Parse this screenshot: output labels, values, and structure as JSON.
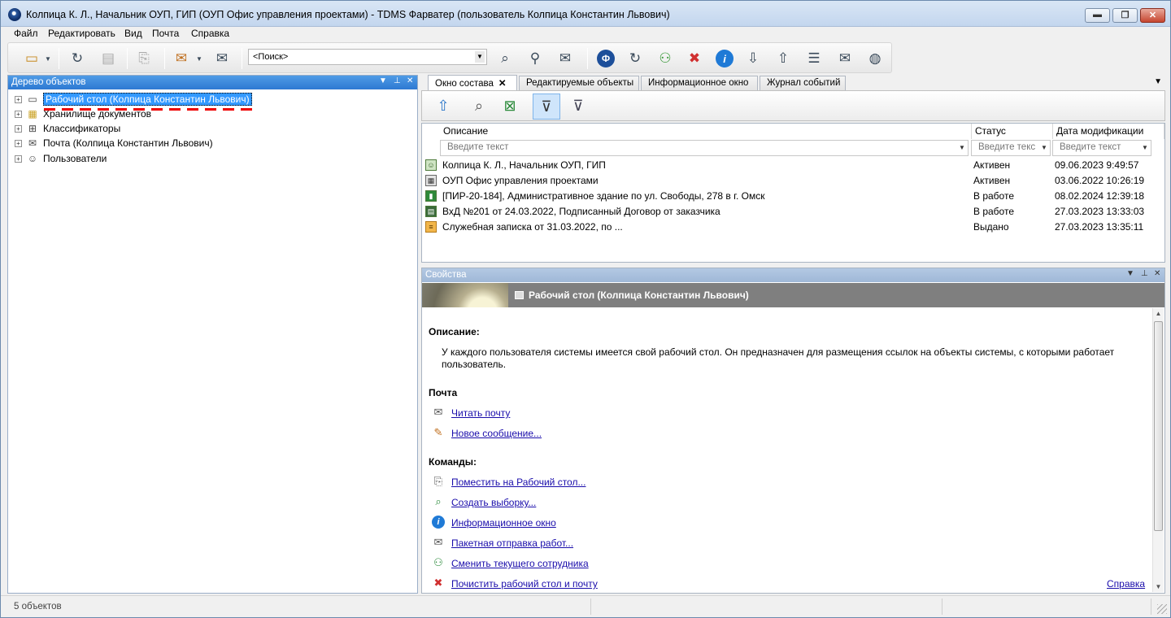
{
  "window": {
    "title": "Колпица К. Л., Начальник ОУП, ГИП (ОУП Офис управления проектами) - TDMS Фарватер (пользователь Колпица Константин Львович)",
    "minimize": "▬",
    "maximize": "❐",
    "close": "✕"
  },
  "menu": [
    "Файл",
    "Редактировать",
    "Вид",
    "Почта",
    "Справка"
  ],
  "toolbar": {
    "search_value": "<Поиск>"
  },
  "tree_panel": {
    "title": "Дерево объектов",
    "items": [
      {
        "label": "Рабочий стол (Колпица Константин Львович)",
        "icon": "desktop-icon"
      },
      {
        "label": "Хранилище документов",
        "icon": "storage-icon"
      },
      {
        "label": "Классификаторы",
        "icon": "classifier-icon"
      },
      {
        "label": "Почта (Колпица Константин Львович)",
        "icon": "mail-icon"
      },
      {
        "label": "Пользователи",
        "icon": "user-icon"
      }
    ]
  },
  "tabs": [
    {
      "label": "Окно состава",
      "active": true
    },
    {
      "label": "Редактируемые объекты"
    },
    {
      "label": "Информационное окно"
    },
    {
      "label": "Журнал событий"
    }
  ],
  "grid": {
    "columns": [
      "Описание",
      "Статус",
      "Дата модификации"
    ],
    "filter_placeholders": [
      "Введите текст",
      "Введите текс",
      "Введите текст"
    ],
    "rows": [
      {
        "desc": "Колпица К. Л., Начальник ОУП, ГИП",
        "status": "Активен",
        "date": "09.06.2023 9:49:57"
      },
      {
        "desc": "ОУП Офис управления проектами",
        "status": "Активен",
        "date": "03.06.2022 10:26:19"
      },
      {
        "desc": "[ПИР-20-184], Административное здание по ул. Свободы, 278 в г. Омск",
        "status": "В работе",
        "date": "08.02.2024 12:39:18"
      },
      {
        "desc": "ВхД №201 от 24.03.2022, Подписанный Договор от заказчика",
        "status": "В работе",
        "date": "27.03.2023 13:33:03"
      },
      {
        "desc": "Служебная записка от 31.03.2022, по ...",
        "status": "Выдано",
        "date": "27.03.2023 13:35:11"
      }
    ]
  },
  "properties": {
    "title": "Свойства",
    "banner_title": "Рабочий стол (Колпица Константин Львович)",
    "description_heading": "Описание:",
    "description_text_line1": "У каждого пользователя системы имеется свой рабочий стол. Он предназначен для размещения ссылок на объекты системы, с которыми работает",
    "description_text_line2": "пользователь.",
    "mail_heading": "Почта",
    "mail_links": [
      "Читать почту",
      "Новое сообщение..."
    ],
    "commands_heading": "Команды:",
    "command_links": [
      "Поместить на Рабочий стол...",
      "Создать выборку...",
      "Информационное окно",
      "Пакетная отправка работ...",
      "Сменить текущего сотрудника",
      "Почистить рабочий стол и почту"
    ],
    "help_link": "Справка"
  },
  "status": {
    "count_text": "5 объектов"
  }
}
